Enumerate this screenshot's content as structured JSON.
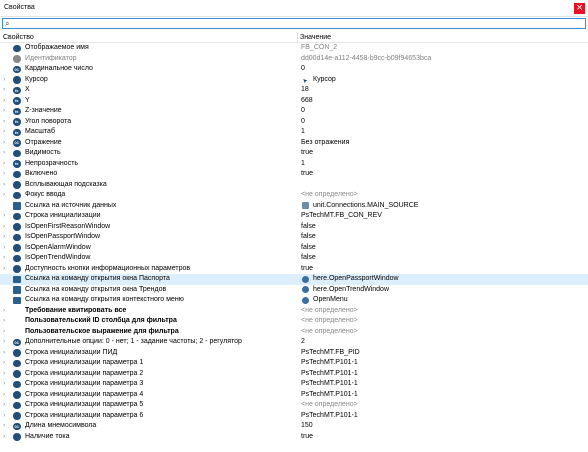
{
  "window": {
    "title": "Свойства",
    "close_glyph": "×"
  },
  "search": {
    "value": "",
    "icon": "search-icon"
  },
  "columns": {
    "property": "Свойство",
    "value": "Значение"
  },
  "rows": [
    {
      "name": "Отображаемое имя",
      "value": "FB_CON_2",
      "expand": false,
      "icon": "gear",
      "name_style": "",
      "value_style": "gray"
    },
    {
      "name": "Идентификатор",
      "value": "dd00d14e-a112-4458-b9cc-b09f94653bca",
      "expand": false,
      "icon": "gear-gray",
      "name_style": "gray",
      "value_style": "gray"
    },
    {
      "name": "Кардинальное число",
      "value": "0",
      "expand": false,
      "icon": "number",
      "name_style": "",
      "value_style": ""
    },
    {
      "name": "Курсор",
      "value": "Курсор",
      "expand": true,
      "icon": "gear",
      "name_style": "",
      "value_style": "",
      "value_icon": "cursor"
    },
    {
      "name": "X",
      "value": "18",
      "expand": true,
      "icon": "fn",
      "name_style": "",
      "value_style": ""
    },
    {
      "name": "Y",
      "value": "668",
      "expand": true,
      "icon": "fn",
      "name_style": "",
      "value_style": ""
    },
    {
      "name": "Z-значение",
      "value": "0",
      "expand": true,
      "icon": "fn",
      "name_style": "",
      "value_style": ""
    },
    {
      "name": "Угол поворота",
      "value": "0",
      "expand": true,
      "icon": "fn",
      "name_style": "",
      "value_style": ""
    },
    {
      "name": "Масштаб",
      "value": "1",
      "expand": true,
      "icon": "fn",
      "name_style": "",
      "value_style": ""
    },
    {
      "name": "Отражение",
      "value": "Без отражения",
      "expand": true,
      "icon": "number",
      "name_style": "",
      "value_style": ""
    },
    {
      "name": "Видимость",
      "value": "true",
      "expand": true,
      "icon": "gear",
      "name_style": "",
      "value_style": ""
    },
    {
      "name": "Непрозрачность",
      "value": "1",
      "expand": true,
      "icon": "fn",
      "name_style": "",
      "value_style": ""
    },
    {
      "name": "Включено",
      "value": "true",
      "expand": true,
      "icon": "gear",
      "name_style": "",
      "value_style": ""
    },
    {
      "name": "Всплывающая подсказка",
      "value": "",
      "expand": true,
      "icon": "gear",
      "name_style": "",
      "value_style": ""
    },
    {
      "name": "Фокус ввода",
      "value": "<не определено>",
      "expand": true,
      "icon": "gear",
      "name_style": "",
      "value_style": "undef"
    },
    {
      "name": "Ссылка на источник данных",
      "value": "unit.Connections.MAIN_SOURCE",
      "expand": false,
      "icon": "link",
      "name_style": "",
      "value_style": "",
      "value_icon": "link"
    },
    {
      "name": "Строка инициализации",
      "value": "PsTechMT.FB_CON_REV",
      "expand": true,
      "icon": "gear",
      "name_style": "",
      "value_style": ""
    },
    {
      "name": "IsOpenFirstReasonWindow",
      "value": "false",
      "expand": true,
      "icon": "gear",
      "name_style": "",
      "value_style": ""
    },
    {
      "name": "IsOpenPassportWindow",
      "value": "false",
      "expand": true,
      "icon": "gear",
      "name_style": "",
      "value_style": ""
    },
    {
      "name": "IsOpenAlarmWindow",
      "value": "false",
      "expand": true,
      "icon": "gear",
      "name_style": "",
      "value_style": ""
    },
    {
      "name": "IsOpenTrendWindow",
      "value": "false",
      "expand": true,
      "icon": "gear",
      "name_style": "",
      "value_style": ""
    },
    {
      "name": "Доступность кнопки информационных параметров",
      "value": "true",
      "expand": true,
      "icon": "gear",
      "name_style": "",
      "value_style": ""
    },
    {
      "name": "Ссылка на команду открытия окна Паспорта",
      "value": "here.OpenPassportWindow",
      "expand": false,
      "icon": "link",
      "name_style": "",
      "value_style": "",
      "value_icon": "cmd",
      "selected": true
    },
    {
      "name": "Ссылка на команду открытия окна Трендов",
      "value": "here.OpenTrendWindow",
      "expand": false,
      "icon": "link",
      "name_style": "",
      "value_style": "",
      "value_icon": "cmd"
    },
    {
      "name": "Ссылка на команду открытия контекстного меню",
      "value": "OpenMenu",
      "expand": false,
      "icon": "link",
      "name_style": "",
      "value_style": "",
      "value_icon": "cmd"
    },
    {
      "name": "Требование квитировать все",
      "value": "<не определено>",
      "expand": true,
      "icon": "none",
      "name_style": "bold",
      "value_style": "undef"
    },
    {
      "name": "Пользовательский ID столбца для фильтра",
      "value": "<не определено>",
      "expand": true,
      "icon": "none",
      "name_style": "bold",
      "value_style": "undef"
    },
    {
      "name": "Пользовательское выражение для фильтра",
      "value": "<не определено>",
      "expand": true,
      "icon": "none",
      "name_style": "bold",
      "value_style": "undef"
    },
    {
      "name": "Дополнительные опции: 0 - нет; 1 - задание частоты; 2 - регулятор",
      "value": "2",
      "expand": true,
      "icon": "number",
      "name_style": "",
      "value_style": ""
    },
    {
      "name": "Строка инициализации ПИД",
      "value": "PsTechMT.FB_PID",
      "expand": true,
      "icon": "gear",
      "name_style": "",
      "value_style": ""
    },
    {
      "name": "Строка инициализации параметра 1",
      "value": "PsTechMT.P101-1",
      "expand": true,
      "icon": "gear",
      "name_style": "",
      "value_style": ""
    },
    {
      "name": "Строка инициализации параметра 2",
      "value": "PsTechMT.P101-1",
      "expand": true,
      "icon": "gear",
      "name_style": "",
      "value_style": ""
    },
    {
      "name": "Строка инициализации параметра 3",
      "value": "PsTechMT.P101-1",
      "expand": true,
      "icon": "gear",
      "name_style": "",
      "value_style": ""
    },
    {
      "name": "Строка инициализации параметра 4",
      "value": "PsTechMT.P101-1",
      "expand": true,
      "icon": "gear",
      "name_style": "",
      "value_style": ""
    },
    {
      "name": "Строка инициализации параметра 5",
      "value": "<не определено>",
      "expand": true,
      "icon": "gear",
      "name_style": "",
      "value_style": "undef"
    },
    {
      "name": "Строка инициализации параметра 6",
      "value": "PsTechMT.P101-1",
      "expand": true,
      "icon": "gear",
      "name_style": "",
      "value_style": ""
    },
    {
      "name": "Длина мнемосимвола",
      "value": "150",
      "expand": true,
      "icon": "number",
      "name_style": "",
      "value_style": ""
    },
    {
      "name": "Наличие тока",
      "value": "true",
      "expand": true,
      "icon": "gear",
      "name_style": "",
      "value_style": ""
    }
  ],
  "icon_glyphs": {
    "fn": "fx",
    "number": "01",
    "gear": "",
    "gear-gray": "",
    "link": "",
    "none": ""
  },
  "colors": {
    "accent": "#3c8dd8",
    "close": "#e81123",
    "selected_row": "#ddeefc",
    "icon": "#1f4f7a"
  }
}
